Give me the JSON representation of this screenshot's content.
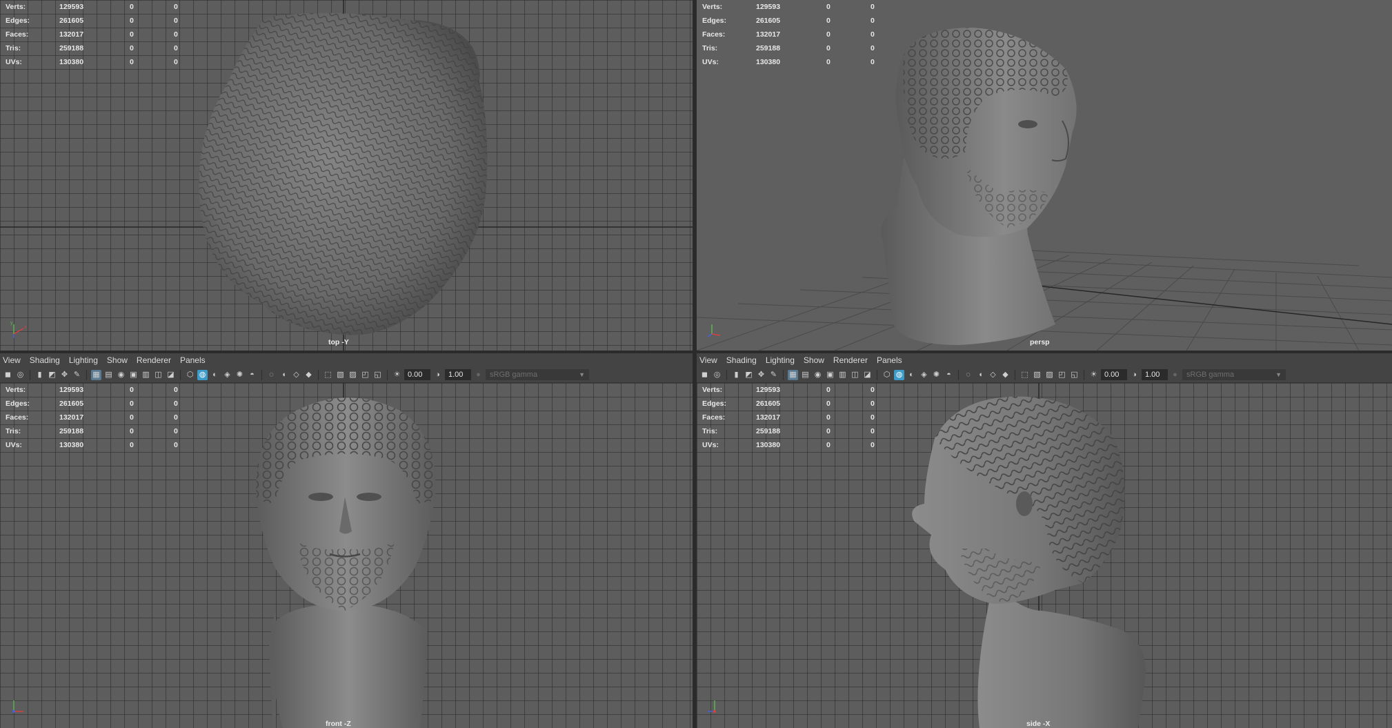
{
  "stats_rows": [
    {
      "label": "Verts:",
      "v1": "129593",
      "v2": "0",
      "v3": "0"
    },
    {
      "label": "Edges:",
      "v1": "261605",
      "v2": "0",
      "v3": "0"
    },
    {
      "label": "Faces:",
      "v1": "132017",
      "v2": "0",
      "v3": "0"
    },
    {
      "label": "Tris:",
      "v1": "259188",
      "v2": "0",
      "v3": "0"
    },
    {
      "label": "UVs:",
      "v1": "130380",
      "v2": "0",
      "v3": "0"
    }
  ],
  "viewports": {
    "top": {
      "camera": "top -Y"
    },
    "persp": {
      "camera": "persp"
    },
    "front": {
      "camera": "front -Z"
    },
    "side": {
      "camera": "side -X"
    }
  },
  "panel_menu": [
    "View",
    "Shading",
    "Lighting",
    "Show",
    "Renderer",
    "Panels"
  ],
  "toolbar": {
    "exposure": "0.00",
    "gamma": "1.00",
    "color_space": "sRGB gamma",
    "icons": [
      "select-camera-icon",
      "camera-attributes-icon",
      "bookmark-icon",
      "image-plane-icon",
      "2d-pan-zoom-icon",
      "grease-pencil-icon",
      "grid-icon",
      "film-gate-icon",
      "resolution-gate-icon",
      "gate-mask-icon",
      "field-chart-icon",
      "safe-action-icon",
      "safe-title-icon",
      "wireframe-icon",
      "smooth-shade-icon",
      "default-material-icon",
      "textured-icon",
      "use-all-lights-icon",
      "shadows-icon",
      "screen-space-ao-icon",
      "motion-blur-icon",
      "multisample-aa-icon",
      "depth-of-field-icon",
      "isolate-select-icon",
      "xray-icon",
      "xray-active-icon",
      "xray-joints-icon",
      "backface-culling-icon"
    ]
  },
  "colors": {
    "viewport_bg": "#5d5d5d",
    "panel_bg": "#444444",
    "highlight": "#3c9bc9",
    "mesh": "#707070"
  }
}
